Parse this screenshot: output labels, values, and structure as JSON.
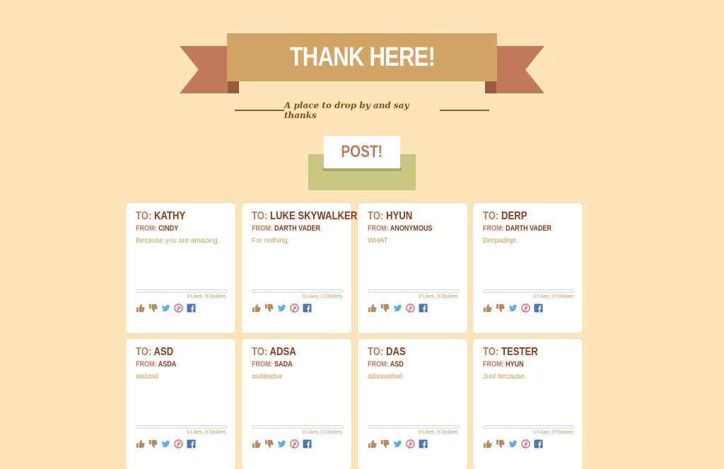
{
  "header": {
    "title": "THANK HERE!",
    "tagline": "A place to drop by and say thanks"
  },
  "post_button": {
    "label": "POST!"
  },
  "labels": {
    "to": "TO:",
    "from": "FROM:"
  },
  "cards": [
    {
      "to": "KATHY",
      "from": "CINDY",
      "message": "Because you are amazing.",
      "counts": "0 Likes, 0 Dislikes"
    },
    {
      "to": "LUKE SKYWALKER",
      "from": "DARTH VADER",
      "message": "For nothing.",
      "counts": "0 Likes, 0 Dislikes"
    },
    {
      "to": "HYUN",
      "from": "ANONYMOUS",
      "message": "WHAT",
      "counts": "0 Likes, 0 Dislikes"
    },
    {
      "to": "DERP",
      "from": "DARTH VADER",
      "message": "Derpadepr.",
      "counts": "0 Likes, 0 Dislikes"
    },
    {
      "to": "ASD",
      "from": "ASDA",
      "message": "asdasd",
      "counts": "0 Likes, 0 Dislikes"
    },
    {
      "to": "ADSA",
      "from": "SADA",
      "message": "asdasdsa",
      "counts": "0 Likes, 0 Dislikes"
    },
    {
      "to": "DAS",
      "from": "ASD",
      "message": "adassadad",
      "counts": "0 Likes, 0 Dislikes"
    },
    {
      "to": "TESTER",
      "from": "HYUN",
      "message": "Just because.",
      "counts": "0 Likes, 0 Dislikes"
    }
  ],
  "card_icons": [
    "thumbs-up-icon",
    "thumbs-down-icon",
    "twitter-icon",
    "pinterest-icon",
    "facebook-icon"
  ],
  "colors": {
    "background": "#fee5b9",
    "banner": "#d3a565",
    "banner_tail": "#c27b5a",
    "post_base": "#c8c883",
    "accent_text": "#8b3a1a"
  }
}
